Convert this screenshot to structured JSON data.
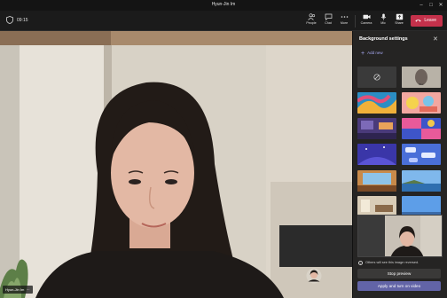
{
  "window": {
    "title": "Hyun-Jin Im",
    "controls": [
      "minimize-icon",
      "maximize-icon",
      "close-icon"
    ]
  },
  "toolbar": {
    "timer": "09:15",
    "buttons": [
      {
        "label": "People",
        "icon": "people-icon"
      },
      {
        "label": "Chat",
        "icon": "chat-icon"
      },
      {
        "label": "More",
        "icon": "more-icon"
      },
      {
        "label": "Camera",
        "icon": "camera-icon"
      },
      {
        "label": "Mic",
        "icon": "mic-icon"
      },
      {
        "label": "Share",
        "icon": "share-icon"
      }
    ],
    "leave_label": "Leave",
    "leave_color": "#c4314b"
  },
  "video": {
    "participant_name": "Hyun-Jin Im"
  },
  "panel": {
    "title": "Background settings",
    "add_new_label": "Add new",
    "thumbnails": [
      {
        "kind": "none",
        "icon": "no-background-icon"
      },
      {
        "kind": "blur",
        "label": "Blur"
      },
      {
        "kind": "image",
        "theme": "abstract-colorful"
      },
      {
        "kind": "image",
        "theme": "abstract-pink"
      },
      {
        "kind": "image",
        "theme": "purple-room"
      },
      {
        "kind": "image",
        "theme": "pink-blue-pattern"
      },
      {
        "kind": "image",
        "theme": "purple-space"
      },
      {
        "kind": "image",
        "theme": "blue-chat-bubbles"
      },
      {
        "kind": "image",
        "theme": "office-window"
      },
      {
        "kind": "image",
        "theme": "sky-coast"
      },
      {
        "kind": "image",
        "theme": "interior-room"
      },
      {
        "kind": "image",
        "theme": "blue-sky"
      }
    ],
    "note": "Others will see this image reversed.",
    "stop_preview_label": "Stop preview",
    "apply_label": "Apply and turn on video",
    "accent_color": "#6264a7"
  }
}
